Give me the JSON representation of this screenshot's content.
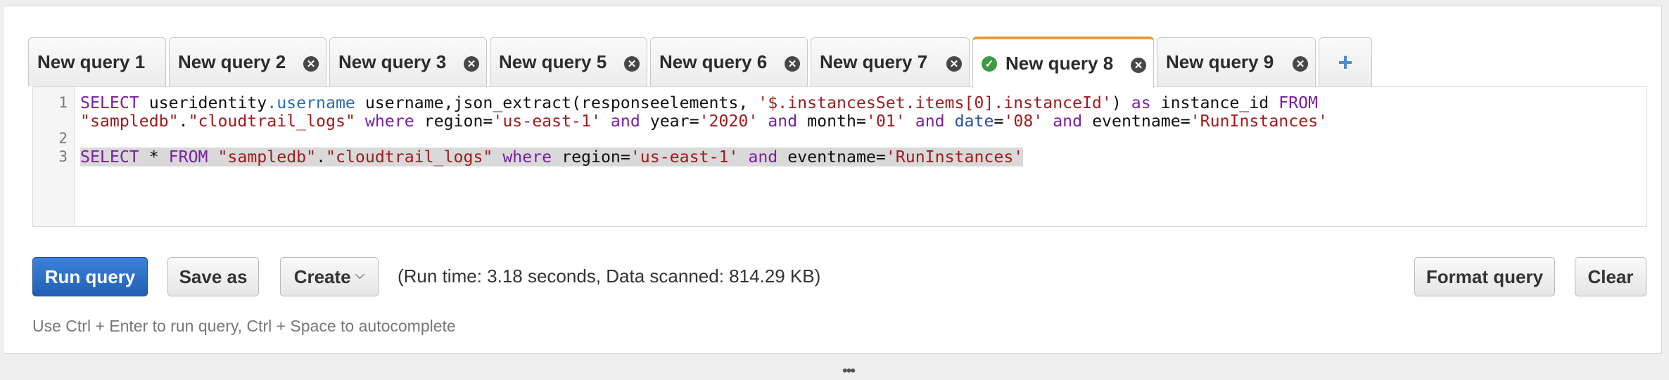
{
  "tabs": [
    {
      "label": "New query 1",
      "closable": false,
      "active": false
    },
    {
      "label": "New query 2",
      "closable": true,
      "active": false
    },
    {
      "label": "New query 3",
      "closable": true,
      "active": false
    },
    {
      "label": "New query 5",
      "closable": true,
      "active": false
    },
    {
      "label": "New query 6",
      "closable": true,
      "active": false
    },
    {
      "label": "New query 7",
      "closable": true,
      "active": false
    },
    {
      "label": "New query 8",
      "closable": true,
      "active": true,
      "status_icon": "check-circle-icon"
    },
    {
      "label": "New query 9",
      "closable": true,
      "active": false
    }
  ],
  "add_tab_label": "+",
  "close_glyph": "✕",
  "check_glyph": "✓",
  "editor": {
    "line_numbers": [
      "1",
      "2",
      "3"
    ],
    "lines": [
      [
        {
          "t": "SELECT",
          "c": "kw"
        },
        {
          "t": " useridentity",
          "c": ""
        },
        {
          "t": ".username",
          "c": "prop"
        },
        {
          "t": " username,json_extract(responseelements, ",
          "c": ""
        },
        {
          "t": "'$.instancesSet.items[0].instanceId'",
          "c": "str"
        },
        {
          "t": ") ",
          "c": ""
        },
        {
          "t": "as",
          "c": "kw"
        },
        {
          "t": " instance_id ",
          "c": ""
        },
        {
          "t": "FROM",
          "c": "kw"
        }
      ],
      [
        {
          "t": "\"sampledb\"",
          "c": "str"
        },
        {
          "t": ".",
          "c": ""
        },
        {
          "t": "\"cloudtrail_logs\"",
          "c": "str"
        },
        {
          "t": " ",
          "c": ""
        },
        {
          "t": "where",
          "c": "kw"
        },
        {
          "t": " region=",
          "c": ""
        },
        {
          "t": "'us-east-1'",
          "c": "str"
        },
        {
          "t": " ",
          "c": ""
        },
        {
          "t": "and",
          "c": "kw"
        },
        {
          "t": " year=",
          "c": ""
        },
        {
          "t": "'2020'",
          "c": "str"
        },
        {
          "t": " ",
          "c": ""
        },
        {
          "t": "and",
          "c": "kw"
        },
        {
          "t": " month=",
          "c": ""
        },
        {
          "t": "'01'",
          "c": "str"
        },
        {
          "t": " ",
          "c": ""
        },
        {
          "t": "and",
          "c": "kw"
        },
        {
          "t": " ",
          "c": ""
        },
        {
          "t": "date",
          "c": "kwb"
        },
        {
          "t": "=",
          "c": ""
        },
        {
          "t": "'08'",
          "c": "str"
        },
        {
          "t": " ",
          "c": ""
        },
        {
          "t": "and",
          "c": "kw"
        },
        {
          "t": " eventname=",
          "c": ""
        },
        {
          "t": "'RunInstances'",
          "c": "str"
        }
      ],
      [],
      [
        {
          "t": "SELECT",
          "c": "kw"
        },
        {
          "t": " * ",
          "c": ""
        },
        {
          "t": "FROM",
          "c": "kw"
        },
        {
          "t": " ",
          "c": ""
        },
        {
          "t": "\"sampledb\"",
          "c": "str"
        },
        {
          "t": ".",
          "c": ""
        },
        {
          "t": "\"cloudtrail_logs\"",
          "c": "str"
        },
        {
          "t": " ",
          "c": ""
        },
        {
          "t": "where",
          "c": "kw"
        },
        {
          "t": " region=",
          "c": ""
        },
        {
          "t": "'us-east-1'",
          "c": "str"
        },
        {
          "t": " ",
          "c": ""
        },
        {
          "t": "and",
          "c": "kw"
        },
        {
          "t": " eventname=",
          "c": ""
        },
        {
          "t": "'RunInstances'",
          "c": "str"
        }
      ]
    ],
    "selected_line_index": 3
  },
  "buttons": {
    "run_query": "Run query",
    "save_as": "Save as",
    "create": "Create",
    "create_caret": "⌵",
    "format_query": "Format query",
    "clear": "Clear"
  },
  "status_text": "(Run time: 3.18 seconds, Data scanned: 814.29 KB)",
  "hint_text": "Use Ctrl + Enter to run query, Ctrl + Space to autocomplete",
  "resize_handle": "•••",
  "colors": {
    "active_tab_accent": "#eb9a2f",
    "primary_button": "#2a6bc4",
    "keyword": "#7a1fa2",
    "string": "#a11b1b",
    "success": "#3e9b43"
  }
}
